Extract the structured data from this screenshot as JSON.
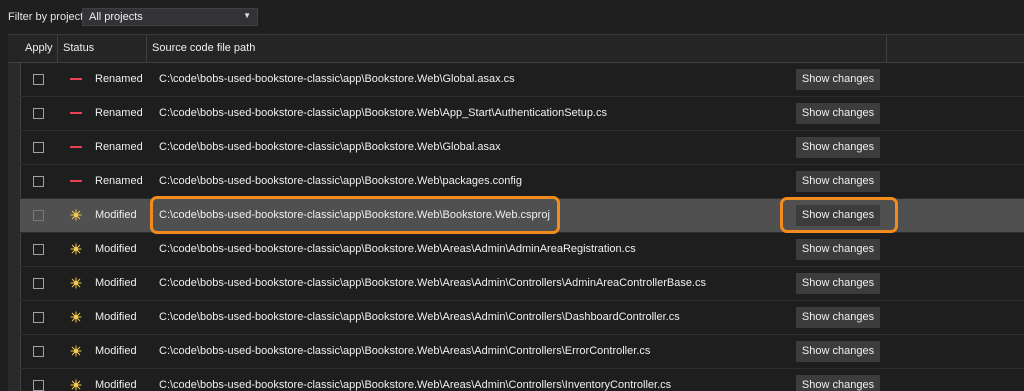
{
  "filter": {
    "label": "Filter by project",
    "selected": "All projects"
  },
  "columns": {
    "apply": "Apply",
    "status": "Status",
    "path": "Source code file path"
  },
  "colors": {
    "renamed_icon": "#e8414f",
    "modified_icon": "#f2c94c",
    "highlight": "#f28c1e"
  },
  "rows": [
    {
      "status": "Renamed",
      "status_icon": "minus-icon",
      "path": "C:\\code\\bobs-used-bookstore-classic\\app\\Bookstore.Web\\Global.asax.cs",
      "button": "Show changes"
    },
    {
      "status": "Renamed",
      "status_icon": "minus-icon",
      "path": "C:\\code\\bobs-used-bookstore-classic\\app\\Bookstore.Web\\App_Start\\AuthenticationSetup.cs",
      "button": "Show changes"
    },
    {
      "status": "Renamed",
      "status_icon": "minus-icon",
      "path": "C:\\code\\bobs-used-bookstore-classic\\app\\Bookstore.Web\\Global.asax",
      "button": "Show changes"
    },
    {
      "status": "Renamed",
      "status_icon": "minus-icon",
      "path": "C:\\code\\bobs-used-bookstore-classic\\app\\Bookstore.Web\\packages.config",
      "button": "Show changes"
    },
    {
      "status": "Modified",
      "status_icon": "sparkle-icon",
      "path": "C:\\code\\bobs-used-bookstore-classic\\app\\Bookstore.Web\\Bookstore.Web.csproj",
      "button": "Show changes",
      "selected": true
    },
    {
      "status": "Modified",
      "status_icon": "sparkle-icon",
      "path": "C:\\code\\bobs-used-bookstore-classic\\app\\Bookstore.Web\\Areas\\Admin\\AdminAreaRegistration.cs",
      "button": "Show changes"
    },
    {
      "status": "Modified",
      "status_icon": "sparkle-icon",
      "path": "C:\\code\\bobs-used-bookstore-classic\\app\\Bookstore.Web\\Areas\\Admin\\Controllers\\AdminAreaControllerBase.cs",
      "button": "Show changes"
    },
    {
      "status": "Modified",
      "status_icon": "sparkle-icon",
      "path": "C:\\code\\bobs-used-bookstore-classic\\app\\Bookstore.Web\\Areas\\Admin\\Controllers\\DashboardController.cs",
      "button": "Show changes"
    },
    {
      "status": "Modified",
      "status_icon": "sparkle-icon",
      "path": "C:\\code\\bobs-used-bookstore-classic\\app\\Bookstore.Web\\Areas\\Admin\\Controllers\\ErrorController.cs",
      "button": "Show changes"
    },
    {
      "status": "Modified",
      "status_icon": "sparkle-icon",
      "path": "C:\\code\\bobs-used-bookstore-classic\\app\\Bookstore.Web\\Areas\\Admin\\Controllers\\InventoryController.cs",
      "button": "Show changes"
    }
  ]
}
